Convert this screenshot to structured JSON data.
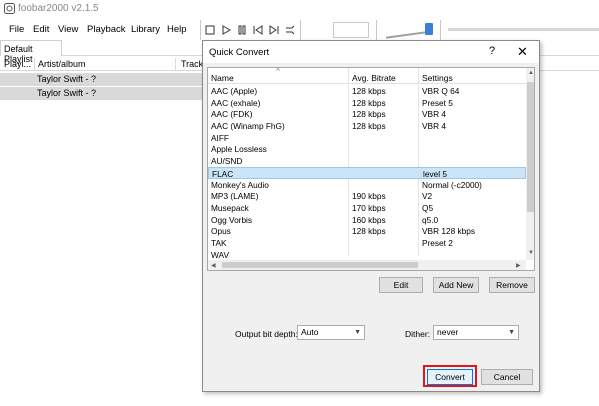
{
  "app": {
    "title": "foobar2000 v2.1.5",
    "menu": [
      "File",
      "Edit",
      "View",
      "Playback",
      "Library",
      "Help"
    ],
    "tab": "Default Playlist",
    "columns": [
      "Playi...",
      "Artist/album",
      "Track"
    ],
    "rows": [
      "Taylor Swift - ?",
      "Taylor Swift - ?"
    ]
  },
  "dialog": {
    "title": "Quick Convert",
    "help": "?",
    "close": "✕",
    "headers": {
      "name": "Name",
      "bitrate": "Avg. Bitrate",
      "settings": "Settings"
    },
    "formats": [
      {
        "name": "AAC (Apple)",
        "bitrate": "128 kbps",
        "settings": "VBR Q 64"
      },
      {
        "name": "AAC (exhale)",
        "bitrate": "128 kbps",
        "settings": "Preset 5"
      },
      {
        "name": "AAC (FDK)",
        "bitrate": "128 kbps",
        "settings": "VBR 4"
      },
      {
        "name": "AAC (Winamp FhG)",
        "bitrate": "128 kbps",
        "settings": "VBR 4"
      },
      {
        "name": "AIFF",
        "bitrate": "",
        "settings": ""
      },
      {
        "name": "Apple Lossless",
        "bitrate": "",
        "settings": ""
      },
      {
        "name": "AU/SND",
        "bitrate": "",
        "settings": ""
      },
      {
        "name": "FLAC",
        "bitrate": "",
        "settings": "level 5",
        "selected": true
      },
      {
        "name": "Monkey's Audio",
        "bitrate": "",
        "settings": "Normal (-c2000)"
      },
      {
        "name": "MP3 (LAME)",
        "bitrate": "190 kbps",
        "settings": "V2"
      },
      {
        "name": "Musepack",
        "bitrate": "170 kbps",
        "settings": "Q5"
      },
      {
        "name": "Ogg Vorbis",
        "bitrate": "160 kbps",
        "settings": "q5.0"
      },
      {
        "name": "Opus",
        "bitrate": "128 kbps",
        "settings": "VBR 128 kbps"
      },
      {
        "name": "TAK",
        "bitrate": "",
        "settings": "Preset 2"
      },
      {
        "name": "WAV",
        "bitrate": "",
        "settings": ""
      }
    ],
    "buttons": {
      "edit": "Edit",
      "add_new": "Add New",
      "remove": "Remove",
      "convert": "Convert",
      "cancel": "Cancel"
    },
    "output_bit_depth": {
      "label": "Output bit depth:",
      "value": "Auto"
    },
    "dither": {
      "label": "Dither:",
      "value": "never"
    },
    "colors": {
      "selection": "#cce4f7",
      "highlight_border": "#e0161e"
    }
  }
}
